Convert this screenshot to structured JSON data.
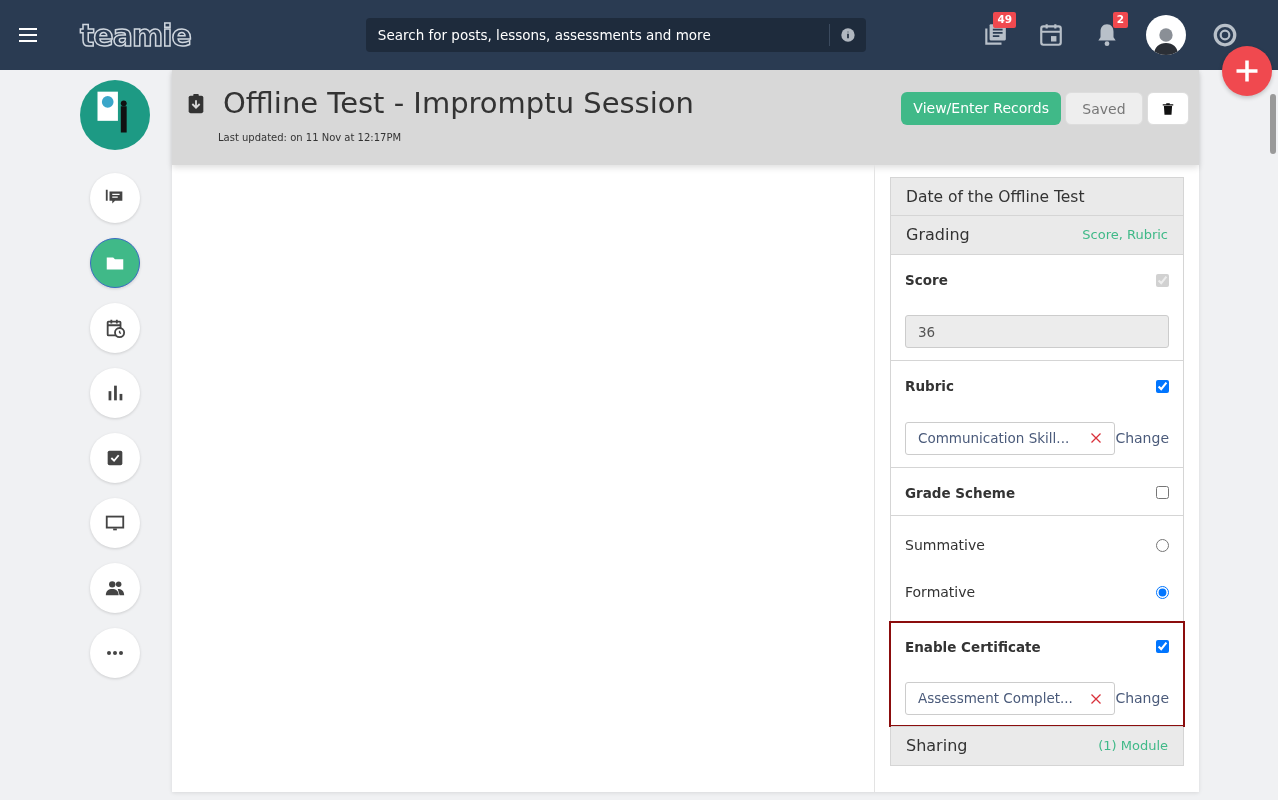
{
  "navbar": {
    "logo": "teamie",
    "search": {
      "placeholder": "Search for posts, lessons, assessments and more"
    },
    "icons": [
      {
        "kind": "posts",
        "badge": "49"
      },
      {
        "kind": "calendar"
      },
      {
        "kind": "bell",
        "badge": "2"
      },
      {
        "kind": "avatar"
      },
      {
        "kind": "help"
      }
    ]
  },
  "sidebar": {
    "items": [
      {
        "kind": "chat",
        "selected": false
      },
      {
        "kind": "folder",
        "selected": true
      },
      {
        "kind": "schedule",
        "selected": false
      },
      {
        "kind": "chart",
        "selected": false
      },
      {
        "kind": "check",
        "selected": false
      },
      {
        "kind": "monitor",
        "selected": false
      },
      {
        "kind": "people",
        "selected": false
      },
      {
        "kind": "more",
        "selected": false
      }
    ]
  },
  "header": {
    "title": "Offline Test - Impromptu Session",
    "updated": "Last updated: on 11 Nov at 12:17PM",
    "buttons": [
      {
        "kind": "primary",
        "label": "View/Enter Records"
      },
      {
        "kind": "saved",
        "label": "Saved"
      },
      {
        "kind": "delete"
      }
    ]
  },
  "panel": [
    {
      "kind": "plain",
      "label": "Date of the Offline Test"
    },
    {
      "kind": "header",
      "label": "Grading",
      "summary": "Score, Rubric"
    },
    {
      "kind": "option",
      "label": "Score",
      "checked": true,
      "disabled": true,
      "value": "36",
      "highlighted": false
    },
    {
      "kind": "option",
      "label": "Rubric",
      "checked": true,
      "disabled": false,
      "chip": "Communication Skill...",
      "action": "Change",
      "highlighted": false
    },
    {
      "kind": "option",
      "label": "Grade Scheme",
      "checked": false,
      "disabled": false,
      "highlighted": false
    },
    {
      "kind": "radios",
      "options": [
        {
          "label": "Summative",
          "selected": false
        },
        {
          "label": "Formative",
          "selected": true
        }
      ]
    },
    {
      "kind": "option",
      "label": "Enable Certificate",
      "checked": true,
      "disabled": false,
      "chip": "Assessment Complet...",
      "action": "Change",
      "highlighted": true
    },
    {
      "kind": "header",
      "label": "Sharing",
      "summary": "(1) Module"
    }
  ]
}
